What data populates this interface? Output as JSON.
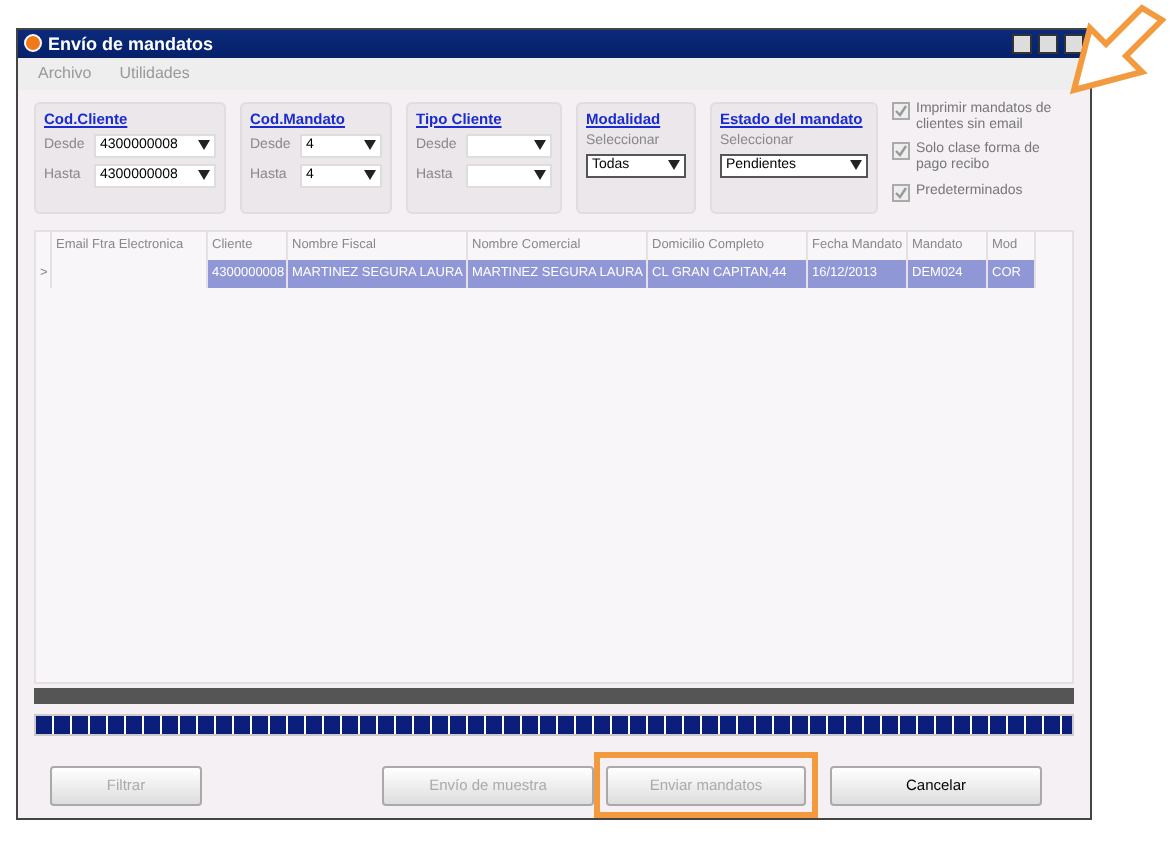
{
  "window": {
    "title": "Envío de mandatos"
  },
  "menu": [
    {
      "label": "Archivo"
    },
    {
      "label": "Utilidades"
    }
  ],
  "filters": [
    {
      "title": "Cod.Cliente",
      "kind": "range",
      "from_label": "Desde",
      "from_value": "4300000008",
      "to_label": "Hasta",
      "to_value": "4300000008"
    },
    {
      "title": "Cod.Mandato",
      "kind": "range",
      "from_label": "Desde",
      "from_value": "4",
      "to_label": "Hasta",
      "to_value": "4"
    },
    {
      "title": "Tipo Cliente",
      "kind": "range",
      "from_label": "Desde",
      "to_label": "Hasta"
    },
    {
      "title": "Modalidad",
      "kind": "select",
      "hint": "Seleccionar",
      "value": "Todas"
    },
    {
      "title": "Estado del mandato",
      "kind": "select",
      "hint": "Seleccionar",
      "value": "Pendientes"
    }
  ],
  "options": [
    {
      "label": "Imprimir mandatos de clientes sin email",
      "checked": true,
      "disabled": true
    },
    {
      "label": "Solo clase forma de pago recibo",
      "checked": true,
      "disabled": true
    },
    {
      "label": "Predeterminados",
      "checked": true,
      "disabled": true
    }
  ],
  "table": {
    "columns": [
      "Email Ftra Electronica",
      "Cliente",
      "Nombre Fiscal",
      "Nombre Comercial",
      "Domicilio Completo",
      "Fecha Mandato",
      "Mandato",
      "Mod"
    ],
    "rows": [
      {
        "pointer": ">",
        "selected": true,
        "cells": [
          "",
          "4300000008",
          "MARTINEZ SEGURA LAURA",
          "MARTINEZ SEGURA LAURA",
          "CL GRAN CAPITAN,44",
          "16/12/2013",
          "DEM024",
          "COR"
        ]
      }
    ]
  },
  "progress": {
    "level": 1
  },
  "buttons": [
    {
      "label": "Filtrar",
      "disabled": true,
      "highlighted": false
    },
    {
      "label": "Envío de muestra",
      "disabled": true,
      "highlighted": false
    },
    {
      "label": "Enviar mandatos",
      "disabled": true,
      "highlighted": true
    },
    {
      "label": "Cancelar",
      "disabled": false,
      "highlighted": false
    }
  ]
}
